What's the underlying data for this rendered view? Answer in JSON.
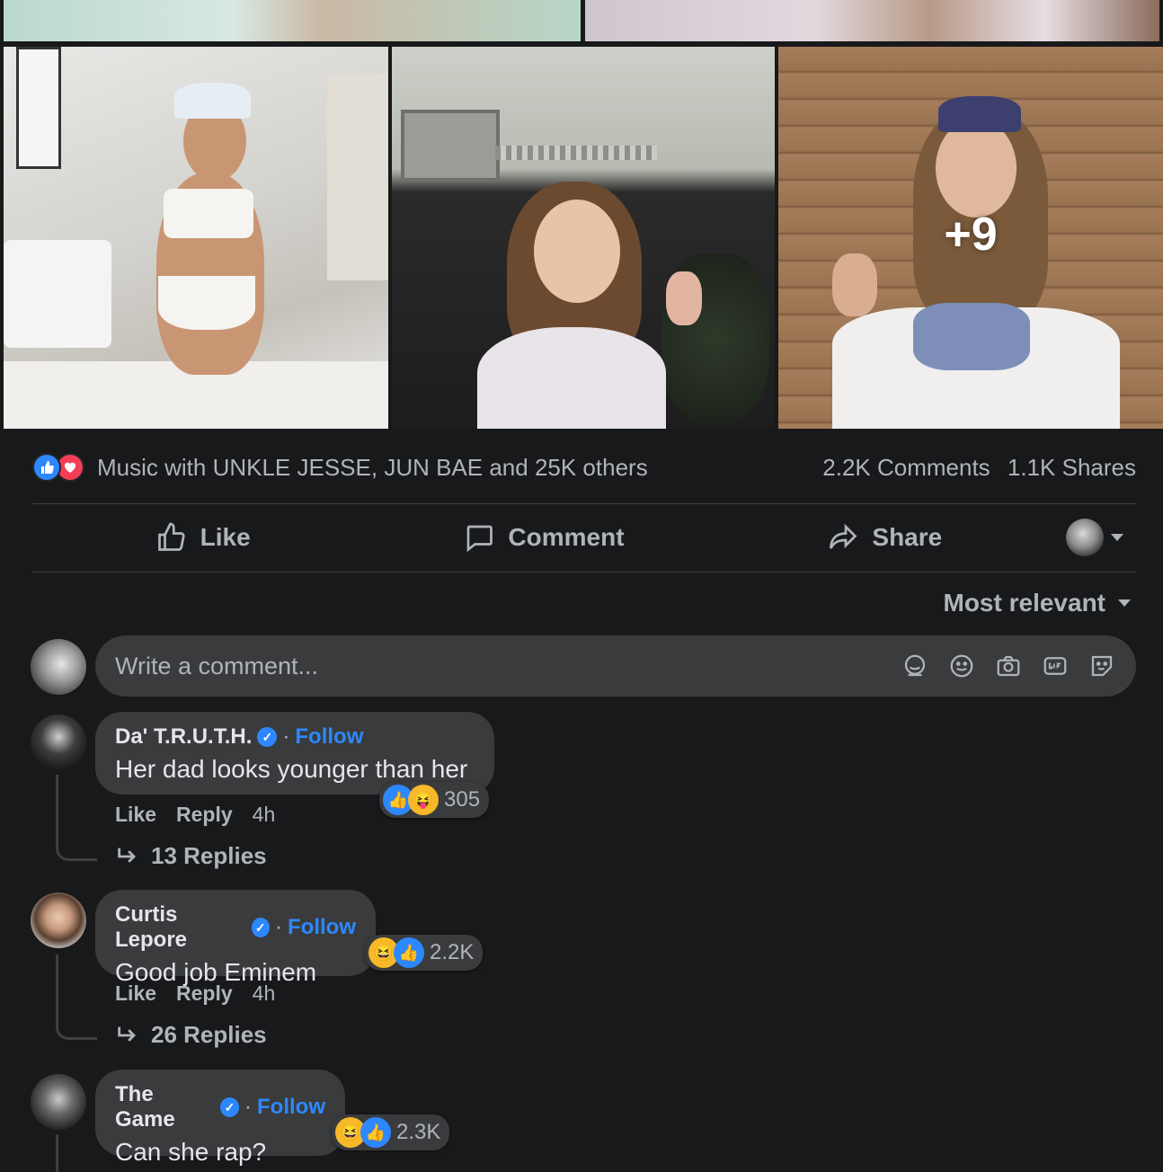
{
  "photos": {
    "more_count": "+9"
  },
  "reactions": {
    "summary": "Music with UNKLE JESSE, JUN BAE and 25K others",
    "comments": "2.2K Comments",
    "shares": "1.1K Shares",
    "icons": [
      "like-icon",
      "love-icon"
    ],
    "colors": {
      "like": "#2d88ff",
      "love": "#f33e58"
    }
  },
  "actions": {
    "like": "Like",
    "comment": "Comment",
    "share": "Share"
  },
  "sort": {
    "label": "Most relevant"
  },
  "composer": {
    "placeholder": "Write a comment..."
  },
  "comments": [
    {
      "name": "Da' T.R.U.T.H.",
      "follow": "Follow",
      "text": "Her dad looks younger than her",
      "reaction_count": "305",
      "like": "Like",
      "reply": "Reply",
      "time": "4h",
      "replies": "13 Replies"
    },
    {
      "name": "Curtis Lepore",
      "follow": "Follow",
      "text": "Good job Eminem",
      "reaction_count": "2.2K",
      "like": "Like",
      "reply": "Reply",
      "time": "4h",
      "replies": "26 Replies"
    },
    {
      "name": "The Game",
      "follow": "Follow",
      "text": "Can she rap?",
      "reaction_count": "2.3K"
    }
  ]
}
